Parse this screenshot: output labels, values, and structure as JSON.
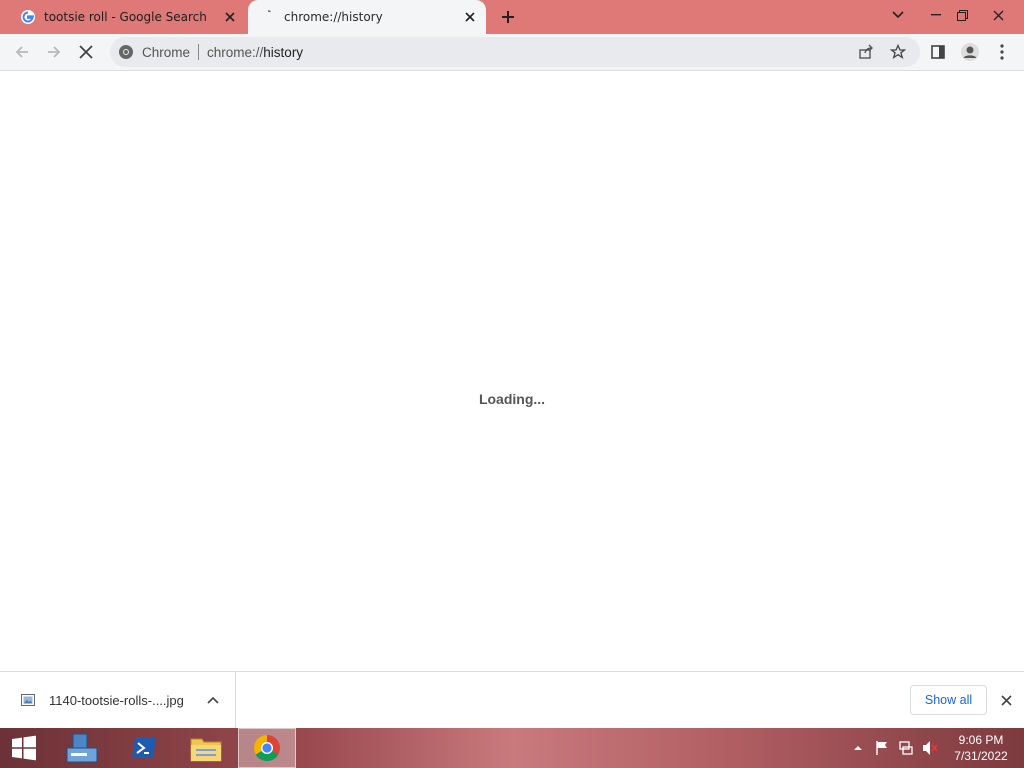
{
  "tabs": [
    {
      "title": "tootsie roll - Google Search",
      "favicon": "google-g-icon",
      "active": false
    },
    {
      "title": "chrome://history",
      "favicon": "loading-spinner-icon",
      "active": true
    }
  ],
  "omnibox": {
    "chip": "Chrome",
    "url_scheme": "chrome://",
    "url_path": "history"
  },
  "content": {
    "status": "Loading..."
  },
  "downloads": {
    "file_name": "1140-tootsie-rolls-....jpg",
    "show_all_label": "Show all"
  },
  "taskbar": {
    "apps": [
      "windows-start-icon",
      "server-manager-icon",
      "powershell-icon",
      "file-explorer-icon",
      "chrome-icon"
    ],
    "clock": {
      "time": "9:06 PM",
      "date": "7/31/2022"
    }
  },
  "colors": {
    "tabstrip": "#de7978",
    "toolbar": "#f4f5f7",
    "accent": "#1a66d8"
  }
}
